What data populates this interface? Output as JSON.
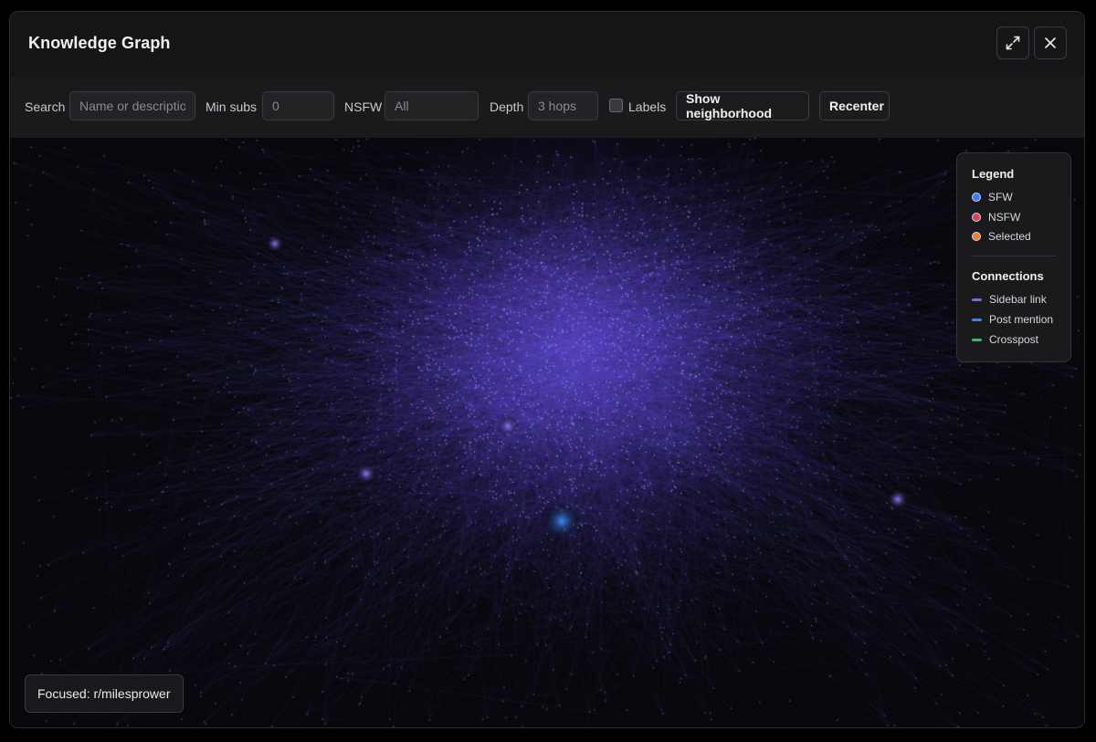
{
  "window": {
    "title": "Knowledge Graph",
    "buttons": {
      "expand_icon": "expand-icon",
      "close_icon": "close-icon"
    }
  },
  "toolbar": {
    "search_label": "Search",
    "search_placeholder": "Name or description",
    "search_value": "",
    "min_subs_label": "Min subs",
    "min_subs_placeholder": "0",
    "min_subs_value": "",
    "nsfw_label": "NSFW",
    "nsfw_placeholder": "All",
    "nsfw_value": "",
    "depth_label": "Depth",
    "depth_placeholder": "3 hops",
    "depth_value": "",
    "labels_checkbox_label": "Labels",
    "labels_checked": false,
    "show_neighborhood_label": "Show neighborhood",
    "recenter_label": "Recenter"
  },
  "legend": {
    "title": "Legend",
    "node_types": [
      {
        "label": "SFW",
        "color": "#3d7cf2"
      },
      {
        "label": "NSFW",
        "color": "#e0424b"
      },
      {
        "label": "Selected",
        "color": "#f07a2e"
      }
    ],
    "connections_title": "Connections",
    "connection_types": [
      {
        "label": "Sidebar link",
        "color": "#8a5cf6"
      },
      {
        "label": "Post mention",
        "color": "#3b82f6"
      },
      {
        "label": "Crosspost",
        "color": "#22c55e"
      }
    ]
  },
  "focused": {
    "text": "Focused: r/milesprower"
  },
  "graph": {
    "background": "#08080c",
    "edge_color": "#6d3fd8",
    "node_color": "#7a8cff"
  }
}
